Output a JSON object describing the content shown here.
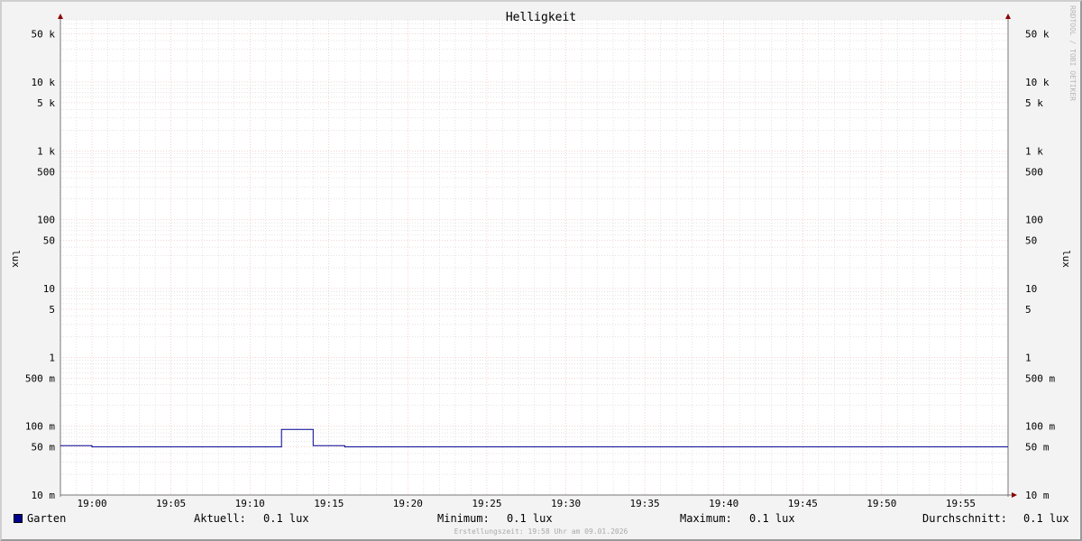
{
  "colors": {
    "background": "#f3f3f3",
    "plot_background": "#ffffff",
    "series": "#000090",
    "major_grid": "#e8a6a6",
    "minor_grid": "#c8c8c8",
    "axis_arrow": "#8b0000"
  },
  "chart_data": {
    "type": "line",
    "title": "Helligkeit",
    "ylabel": "lux",
    "yscale": "log",
    "ylim": [
      0.01,
      80000
    ],
    "xlim": [
      "18:58",
      "19:58"
    ],
    "x_ticks": [
      "19:00",
      "19:05",
      "19:10",
      "19:15",
      "19:20",
      "19:25",
      "19:30",
      "19:35",
      "19:40",
      "19:45",
      "19:50",
      "19:55"
    ],
    "y_ticks": [
      {
        "value": 50000,
        "label": "50 k"
      },
      {
        "value": 10000,
        "label": "10 k"
      },
      {
        "value": 5000,
        "label": "5 k"
      },
      {
        "value": 1000,
        "label": "1 k"
      },
      {
        "value": 500,
        "label": "500"
      },
      {
        "value": 100,
        "label": "100"
      },
      {
        "value": 50,
        "label": "50"
      },
      {
        "value": 10,
        "label": "10"
      },
      {
        "value": 5,
        "label": "5"
      },
      {
        "value": 1,
        "label": "1"
      },
      {
        "value": 0.5,
        "label": "500 m"
      },
      {
        "value": 0.1,
        "label": "100 m"
      },
      {
        "value": 0.05,
        "label": "50 m"
      },
      {
        "value": 0.01,
        "label": "10 m"
      }
    ],
    "grid": true,
    "series": [
      {
        "name": "Garten",
        "color": "#000090",
        "points": [
          {
            "x": "18:58",
            "y": 0.052
          },
          {
            "x": "19:00",
            "y": 0.052
          },
          {
            "x": "19:00",
            "y": 0.05
          },
          {
            "x": "19:12",
            "y": 0.05
          },
          {
            "x": "19:12",
            "y": 0.09
          },
          {
            "x": "19:14",
            "y": 0.09
          },
          {
            "x": "19:14",
            "y": 0.052
          },
          {
            "x": "19:16",
            "y": 0.052
          },
          {
            "x": "19:16",
            "y": 0.05
          },
          {
            "x": "19:58",
            "y": 0.05
          }
        ]
      }
    ]
  },
  "legend": {
    "series_name": "Garten",
    "current_label": "Aktuell:",
    "current_value": "0.1 lux",
    "min_label": "Minimum:",
    "min_value": "0.1 lux",
    "max_label": "Maximum:",
    "max_value": "0.1 lux",
    "avg_label": "Durchschnitt:",
    "avg_value": "0.1 lux"
  },
  "footer": "Erstellungszeit: 19:58 Uhr am 09.01.2026",
  "watermark": "RRDTOOL / TOBI OETIKER"
}
